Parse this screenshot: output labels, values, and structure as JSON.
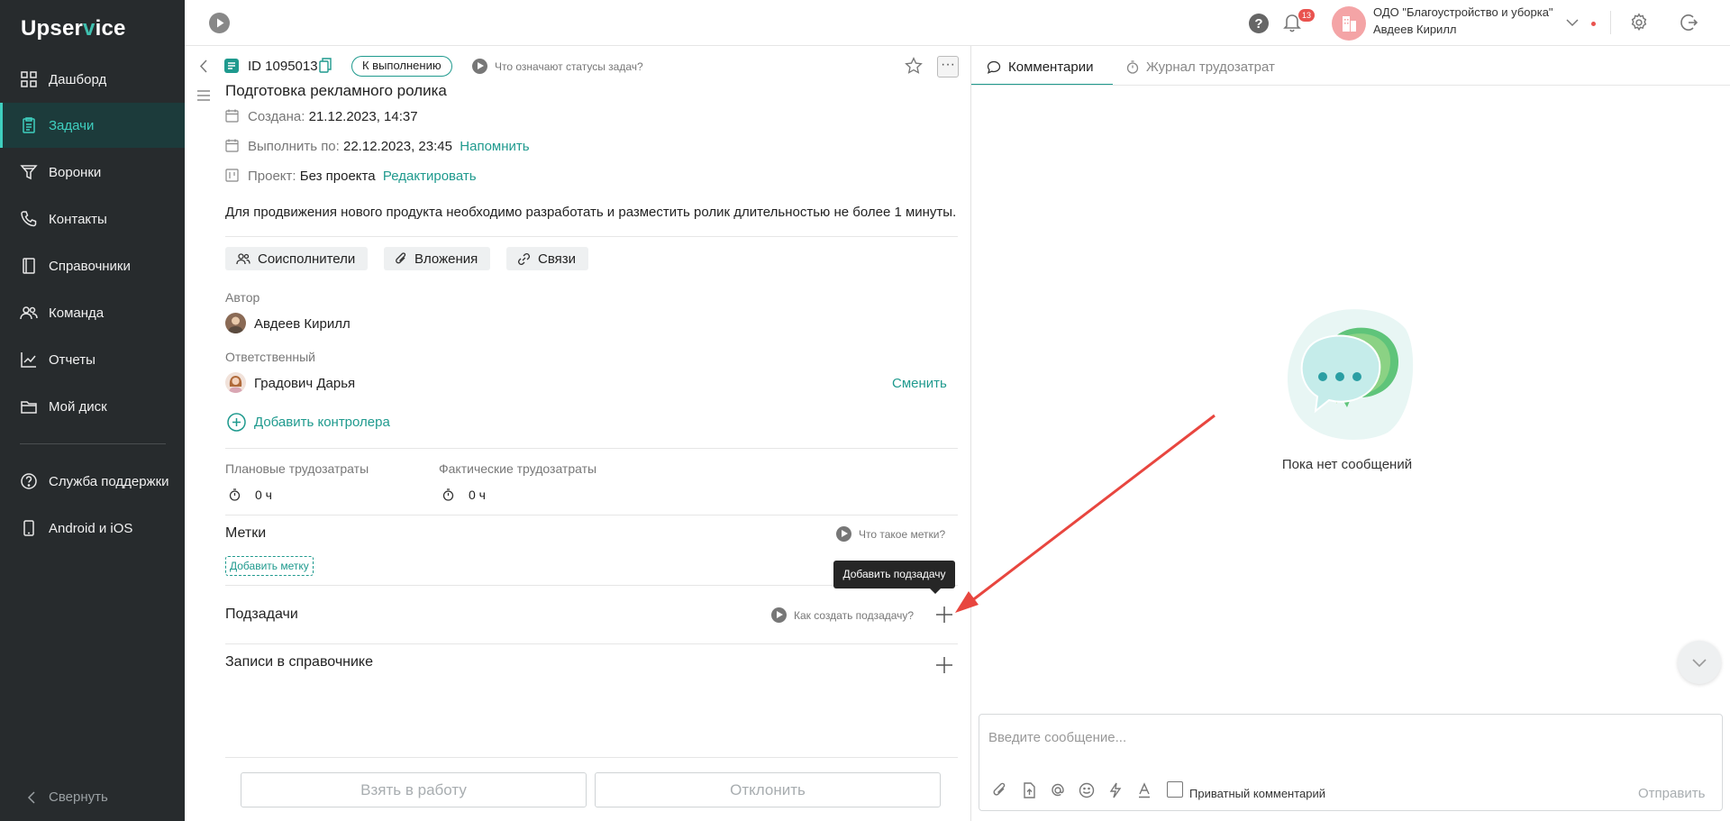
{
  "app": {
    "logo_prefix": "Upser",
    "logo_accent": "v",
    "logo_suffix": "ice",
    "accent_color": "#3fcfbf",
    "sidebar_bg": "#272b2d"
  },
  "sidebar": {
    "items": [
      {
        "label": "Дашборд",
        "icon": "dashboard-icon"
      },
      {
        "label": "Задачи",
        "icon": "tasks-icon",
        "active": true
      },
      {
        "label": "Воронки",
        "icon": "funnel-icon"
      },
      {
        "label": "Контакты",
        "icon": "phone-icon"
      },
      {
        "label": "Справочники",
        "icon": "book-icon"
      },
      {
        "label": "Команда",
        "icon": "team-icon"
      },
      {
        "label": "Отчеты",
        "icon": "chart-icon"
      },
      {
        "label": "Мой диск",
        "icon": "folder-icon"
      }
    ],
    "bottom_items": [
      {
        "label": "Служба поддержки",
        "icon": "help-icon"
      },
      {
        "label": "Android и iOS",
        "icon": "mobile-icon"
      }
    ],
    "collapse_label": "Свернуть"
  },
  "topbar": {
    "notifications_count": "13",
    "org_name": "ОДО \"Благоустройство и уборка\"",
    "user_name": "Авдеев Кирилл"
  },
  "task": {
    "id": "ID 1095013",
    "status": "К выполнению",
    "status_help": "Что означают статусы задач?",
    "title": "Подготовка рекламного ролика",
    "created_label": "Создана:",
    "created_value": "21.12.2023, 14:37",
    "due_label": "Выполнить по:",
    "due_value": "22.12.2023, 23:45",
    "remind_link": "Напомнить",
    "project_label": "Проект:",
    "project_value": "Без проекта",
    "edit_link": "Редактировать",
    "description": "Для продвижения нового продукта необходимо разработать и разместить ролик длительностью не более 1 минуты.",
    "chips": [
      "Соисполнители",
      "Вложения",
      "Связи"
    ],
    "author_label": "Автор",
    "author_name": "Авдеев Кирилл",
    "assignee_label": "Ответственный",
    "assignee_name": "Градович Дарья",
    "change_link": "Сменить",
    "add_controller": "Добавить контролера",
    "planned_label": "Плановые трудозатраты",
    "planned_value": "0 ч",
    "actual_label": "Фактические трудозатраты",
    "actual_value": "0 ч",
    "tags_title": "Метки",
    "tags_help": "Что такое метки?",
    "add_tag": "Добавить метку",
    "subtasks_title": "Подзадачи",
    "subtasks_help": "Как создать подзадачу?",
    "subtask_tooltip": "Добавить подзадачу",
    "records_title": "Записи в справочнике",
    "take_button": "Взять в работу",
    "reject_button": "Отклонить"
  },
  "comments": {
    "tab_comments": "Комментарии",
    "tab_worklog": "Журнал трудозатрат",
    "empty_text": "Пока нет сообщений",
    "input_placeholder": "Введите сообщение...",
    "private_label": "Приватный комментарий",
    "send_label": "Отправить"
  }
}
